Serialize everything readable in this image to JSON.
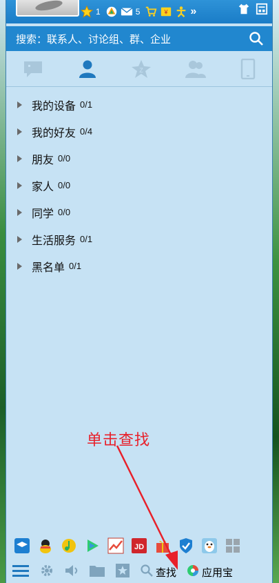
{
  "header": {
    "star_count": "1",
    "mail_count": "5",
    "more_glyph": "»"
  },
  "search": {
    "placeholder": "搜索：联系人、讨论组、群、企业"
  },
  "tabs": [
    "messages",
    "contacts",
    "favorites",
    "groups",
    "devices"
  ],
  "groups": [
    {
      "name": "我的设备",
      "count": "0/1"
    },
    {
      "name": "我的好友",
      "count": "0/4"
    },
    {
      "name": "朋友",
      "count": "0/0"
    },
    {
      "name": "家人",
      "count": "0/0"
    },
    {
      "name": "同学",
      "count": "0/0"
    },
    {
      "name": "生活服务",
      "count": "0/1"
    },
    {
      "name": "黑名单",
      "count": "0/1"
    }
  ],
  "bottom": {
    "find_label": "查找",
    "appstore_label": "应用宝"
  },
  "annotation": {
    "text": "单击查找"
  },
  "colors": {
    "accent": "#1a7cc7",
    "panel": "#c6e2f4",
    "annotation": "#e8202a"
  }
}
